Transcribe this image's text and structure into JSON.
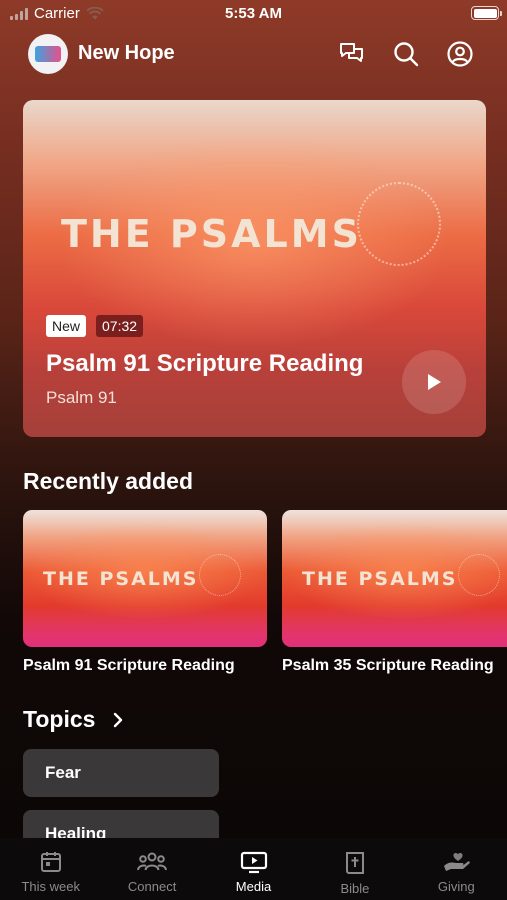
{
  "status_bar": {
    "carrier": "Carrier",
    "time": "5:53 AM"
  },
  "header": {
    "church_name": "New Hope"
  },
  "featured": {
    "art_title": "THE PSALMS",
    "badge_new": "New",
    "duration": "07:32",
    "title": "Psalm 91 Scripture Reading",
    "subtitle": "Psalm 91"
  },
  "recently_added": {
    "heading": "Recently added",
    "items": [
      {
        "art_title": "THE PSALMS",
        "title": "Psalm 91 Scripture Reading"
      },
      {
        "art_title": "THE PSALMS",
        "title": "Psalm 35 Scripture Reading"
      }
    ]
  },
  "topics": {
    "heading": "Topics",
    "items": [
      "Fear",
      "Healing"
    ]
  },
  "tabs": [
    {
      "label": "This week",
      "icon": "calendar-icon",
      "active": false
    },
    {
      "label": "Connect",
      "icon": "people-icon",
      "active": false
    },
    {
      "label": "Media",
      "icon": "tv-play-icon",
      "active": true
    },
    {
      "label": "Bible",
      "icon": "bible-icon",
      "active": false
    },
    {
      "label": "Giving",
      "icon": "giving-hand-icon",
      "active": false
    }
  ],
  "colors": {
    "accent_badge": "#7a1e1e",
    "chip": "#3a3838",
    "tab_inactive": "#8c8a8a"
  }
}
